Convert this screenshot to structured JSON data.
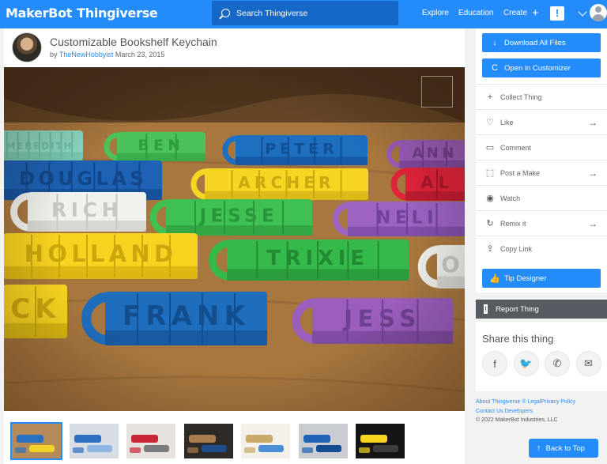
{
  "header": {
    "brand_part1": "MakerBot",
    "brand_part2": "Thingiverse",
    "search_placeholder": "Search Thingiverse",
    "nav_explore": "Explore",
    "nav_education": "Education",
    "nav_create": "Create",
    "alert_glyph": "!",
    "accent_color": "#248bfb"
  },
  "thing": {
    "title": "Customizable Bookshelf Keychain",
    "by": "by",
    "author": "TheNewHobbyist",
    "date": "March 23, 2015"
  },
  "photo": {
    "keychains": [
      {
        "text": "MEREDITH",
        "color": "#8fd9c4",
        "dark": "#6cbfa8"
      },
      {
        "text": "BEN",
        "color": "#4cc35a",
        "dark": "#2f9c3d"
      },
      {
        "text": "PETER",
        "color": "#1e6fc0",
        "dark": "#124f94"
      },
      {
        "text": "ANN",
        "color": "#9b5cb8",
        "dark": "#723e8c"
      },
      {
        "text": "DOUGLAS",
        "color": "#1d62b5",
        "dark": "#13478a"
      },
      {
        "text": "ARCHER",
        "color": "#f7d523",
        "dark": "#c9a90f"
      },
      {
        "text": "AL",
        "color": "#e2233a",
        "dark": "#a9172a"
      },
      {
        "text": "RICH",
        "color": "#f1f1ee",
        "dark": "#c8c8c2"
      },
      {
        "text": "JESSE",
        "color": "#3fc052",
        "dark": "#2a963a"
      },
      {
        "text": "NELI",
        "color": "#9c63c3",
        "dark": "#71439a"
      },
      {
        "text": "HOLLAND",
        "color": "#f7d21f",
        "dark": "#cba70c"
      },
      {
        "text": "TRIXIE",
        "color": "#36b94b",
        "dark": "#238a34"
      },
      {
        "text": "CK",
        "color": "#f7d41f",
        "dark": "#caa60c"
      },
      {
        "text": "FRANK",
        "color": "#1f6dbd",
        "dark": "#134f8f"
      },
      {
        "text": "JESS",
        "color": "#9b5ebd",
        "dark": "#6f4192"
      },
      {
        "text": "O",
        "color": "#eeeeea",
        "dark": "#c6c6c0"
      }
    ]
  },
  "thumbnails": [
    {
      "label": "keychain-collection",
      "bg": "#b48a58",
      "a": "#2a70c2",
      "b": "#f1d12a",
      "selected": true
    },
    {
      "label": "blue-keychain-closeup",
      "bg": "#d8dde3",
      "a": "#2d6fc1",
      "b": "#8fb7e6",
      "selected": false
    },
    {
      "label": "red-keychain-with-keys",
      "bg": "#e6e3de",
      "a": "#c92534",
      "b": "#7c7c7c",
      "selected": false
    },
    {
      "label": "books-on-shelf",
      "bg": "#2e2a26",
      "a": "#a97b4d",
      "b": "#1e4e8c",
      "selected": false
    },
    {
      "label": "keychain-with-tag",
      "bg": "#f3f0ea",
      "a": "#c9a968",
      "b": "#4d8ed9",
      "selected": false
    },
    {
      "label": "blue-keychain-render",
      "bg": "#c9ccd1",
      "a": "#1f63b7",
      "b": "#124c92",
      "selected": false
    },
    {
      "label": "customizer-screenshot",
      "bg": "#151515",
      "a": "#f4d41e",
      "b": "#3d3d3d",
      "selected": false
    }
  ],
  "sidebar": {
    "download_label": "Download All Files",
    "customizer_label": "Open in Customizer",
    "items": [
      {
        "label": "Collect Thing",
        "icon": "+",
        "has_arrow": false,
        "name": "collect-thing"
      },
      {
        "label": "Like",
        "icon": "♡",
        "has_arrow": true,
        "name": "like"
      },
      {
        "label": "Comment",
        "icon": "▭",
        "has_arrow": false,
        "name": "comment"
      },
      {
        "label": "Post a Make",
        "icon": "⬚",
        "has_arrow": true,
        "name": "post-a-make"
      },
      {
        "label": "Watch",
        "icon": "◉",
        "has_arrow": false,
        "name": "watch"
      },
      {
        "label": "Remix it",
        "icon": "↻",
        "has_arrow": true,
        "name": "remix-it"
      },
      {
        "label": "Copy Link",
        "icon": "⇪",
        "has_arrow": false,
        "name": "copy-link"
      }
    ],
    "arrow_glyph": "→",
    "tip_label": "Tip Designer",
    "report_label": "Report Thing",
    "report_glyph": "!"
  },
  "share": {
    "title": "Share this thing",
    "buttons": [
      {
        "name": "facebook-icon",
        "glyph": "f"
      },
      {
        "name": "twitter-icon",
        "glyph": "🐦"
      },
      {
        "name": "whatsapp-icon",
        "glyph": "✆"
      },
      {
        "name": "email-icon",
        "glyph": "✉"
      }
    ]
  },
  "footer": {
    "about": "About Thingiverse ®",
    "legal": "Legal",
    "privacy": "Privacy Policy",
    "contact": "Contact Us",
    "developers": "Developers",
    "copyright": "©  2022  MakerBot Industries, LLC"
  },
  "back_to_top": "Back to Top"
}
